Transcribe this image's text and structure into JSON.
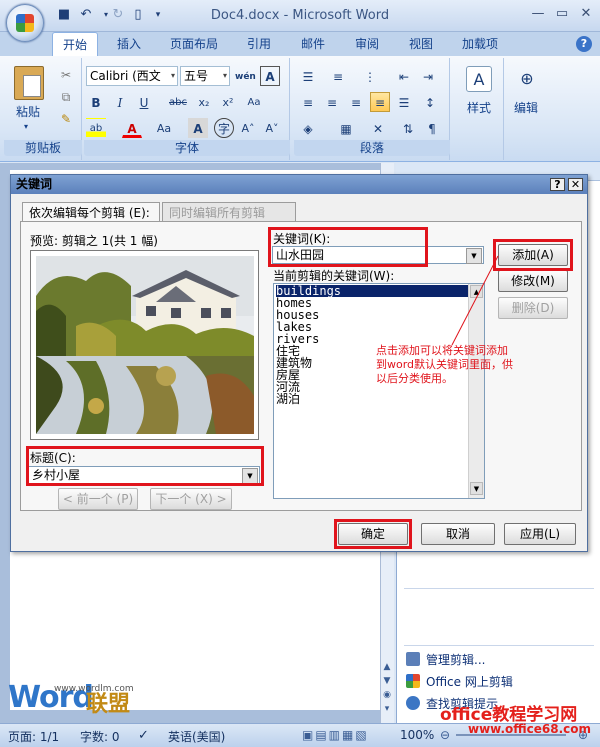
{
  "window": {
    "title": "Doc4.docx - Microsoft Word",
    "tabs": [
      "开始",
      "插入",
      "页面布局",
      "引用",
      "邮件",
      "审阅",
      "视图",
      "加载项"
    ]
  },
  "ribbon": {
    "clipboard": {
      "label": "剪贴板",
      "paste": "粘贴"
    },
    "font": {
      "label": "字体",
      "name": "Calibri (西文",
      "size": "五号"
    },
    "paragraph": {
      "label": "段落"
    },
    "styles": {
      "label": "样式"
    },
    "editing": {
      "label": "编辑"
    }
  },
  "dialog": {
    "title": "关键词",
    "tabs": [
      "依次编辑每个剪辑 (E):",
      "同时编辑所有剪辑 (O):"
    ],
    "preview_label": "预览:  剪辑之 1(共 1 幅)",
    "caption_label": "标题(C):",
    "caption_value": "乡村小屋",
    "prev_button": "< 前一个 (P)",
    "next_button": "下一个 (X) >",
    "keyword_label": "关键词(K):",
    "keyword_value": "山水田园",
    "current_keywords_label": "当前剪辑的关键词(W):",
    "keywords": [
      "buildings",
      "homes",
      "houses",
      "lakes",
      "rivers",
      "住宅",
      "建筑物",
      "房屋",
      "河流",
      "湖泊"
    ],
    "add_button": "添加(A)",
    "modify_button": "修改(M)",
    "delete_button": "删除(D)",
    "ok_button": "确定",
    "cancel_button": "取消",
    "apply_button": "应用(L)",
    "annotation": "点击添加可以将关键词添加到word默认关键词里面，供以后分类使用。"
  },
  "pane": {
    "links": [
      "管理剪辑...",
      "Office 网上剪辑",
      "查找剪辑提示"
    ]
  },
  "statusbar": {
    "page": "页面: 1/1",
    "words": "字数: 0",
    "language": "英语(美国)",
    "zoom": "100%"
  },
  "watermark": {
    "word": "Word",
    "union": "联盟",
    "url": "www.wordlm.com",
    "site": "office教程学习网",
    "site_url": "www.office68.com"
  },
  "colors": {
    "highlight": "#e0141c",
    "selection": "#0a246a",
    "accent": "#15428b"
  }
}
